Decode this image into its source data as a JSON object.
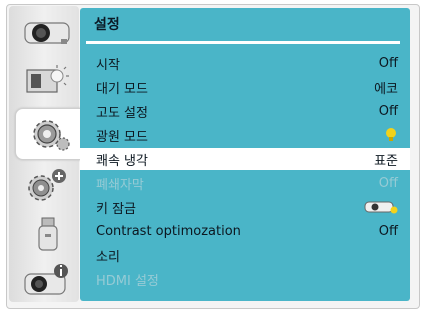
{
  "menu": {
    "title": "설정",
    "sidebar": [
      {
        "name": "sidebar-item-projector",
        "icon": "projector-icon"
      },
      {
        "name": "sidebar-item-image",
        "icon": "image-brightness-icon"
      },
      {
        "name": "sidebar-item-settings",
        "icon": "gear-icon",
        "active": true
      },
      {
        "name": "sidebar-item-extended",
        "icon": "gear-plus-icon"
      },
      {
        "name": "sidebar-item-usb",
        "icon": "usb-icon"
      },
      {
        "name": "sidebar-item-info",
        "icon": "projector-info-icon"
      }
    ],
    "rows": [
      {
        "label": "시작",
        "value": "Off"
      },
      {
        "label": "대기 모드",
        "value": "에코"
      },
      {
        "label": "고도 설정",
        "value": "Off"
      },
      {
        "label": "광원 모드",
        "value_icon": "lamp-icon"
      },
      {
        "label": "쾌속 냉각",
        "value": "표준",
        "selected": true
      },
      {
        "label": "폐쇄자막",
        "value": "Off",
        "disabled": true
      },
      {
        "label": "키 잠금",
        "value_icon": "projector-lock-icon"
      },
      {
        "label": "Contrast optimozation",
        "value": "Off"
      },
      {
        "label": "소리",
        "value": ""
      },
      {
        "label": "HDMI 설정",
        "value": "",
        "disabled": true
      }
    ]
  },
  "colors": {
    "panel": "#4ab5c8",
    "selected_row": "#ffffff",
    "text": "#0c1720",
    "disabled_text": "#96cbd5",
    "lamp": "#f2d21b"
  }
}
